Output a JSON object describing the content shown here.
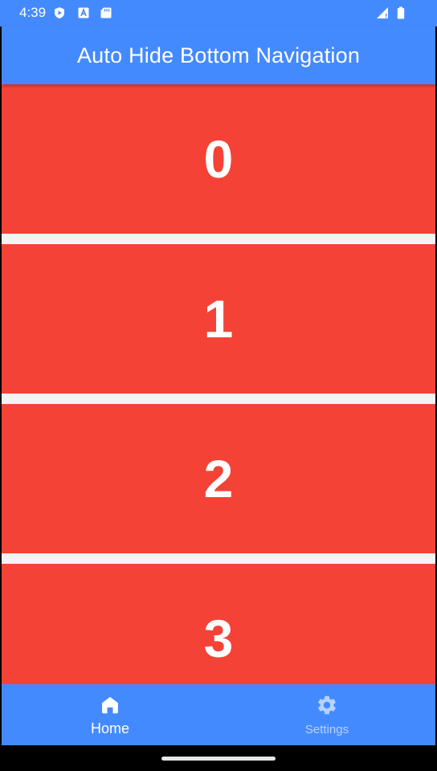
{
  "status_bar": {
    "time": "4:39",
    "icons_left": [
      "play-protect-icon",
      "accessibility-icon",
      "sd-card-icon"
    ],
    "icons_right": [
      "cell-signal-icon",
      "battery-icon"
    ]
  },
  "app_bar": {
    "title": "Auto Hide Bottom Navigation"
  },
  "list": {
    "items": [
      {
        "label": "0"
      },
      {
        "label": "1"
      },
      {
        "label": "2"
      },
      {
        "label": "3"
      }
    ]
  },
  "bottom_nav": {
    "items": [
      {
        "label": "Home",
        "icon": "home-icon",
        "active": true
      },
      {
        "label": "Settings",
        "icon": "gear-icon",
        "active": false
      }
    ]
  },
  "colors": {
    "primary": "#448AFF",
    "item_background": "#F44336",
    "list_background": "#F3F3F3",
    "system_bar": "#000000"
  }
}
